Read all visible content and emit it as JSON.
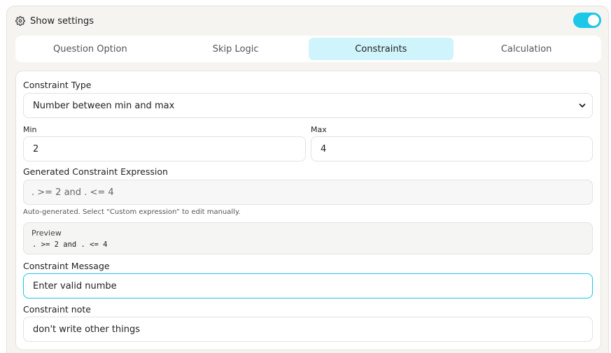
{
  "header": {
    "label": "Show settings",
    "icon": "gear-icon",
    "toggle_on": true,
    "accent": "#1cc7e8"
  },
  "tabs": [
    {
      "label": "Question Option",
      "active": false
    },
    {
      "label": "Skip Logic",
      "active": false
    },
    {
      "label": "Constraints",
      "active": true
    },
    {
      "label": "Calculation",
      "active": false
    }
  ],
  "constraint_type": {
    "label": "Constraint Type",
    "value": "Number between min and max"
  },
  "min": {
    "label": "Min",
    "value": "2"
  },
  "max": {
    "label": "Max",
    "value": "4"
  },
  "expression": {
    "label": "Generated Constraint Expression",
    "value": ". >= 2 and . <= 4",
    "hint": "Auto-generated. Select “Custom expression” to edit manually."
  },
  "preview": {
    "title": "Preview",
    "code": ". >= 2 and . <= 4"
  },
  "message": {
    "label": "Constraint Message",
    "value": "Enter valid numbe"
  },
  "note": {
    "label": "Constraint note",
    "value": "don't write other things"
  }
}
